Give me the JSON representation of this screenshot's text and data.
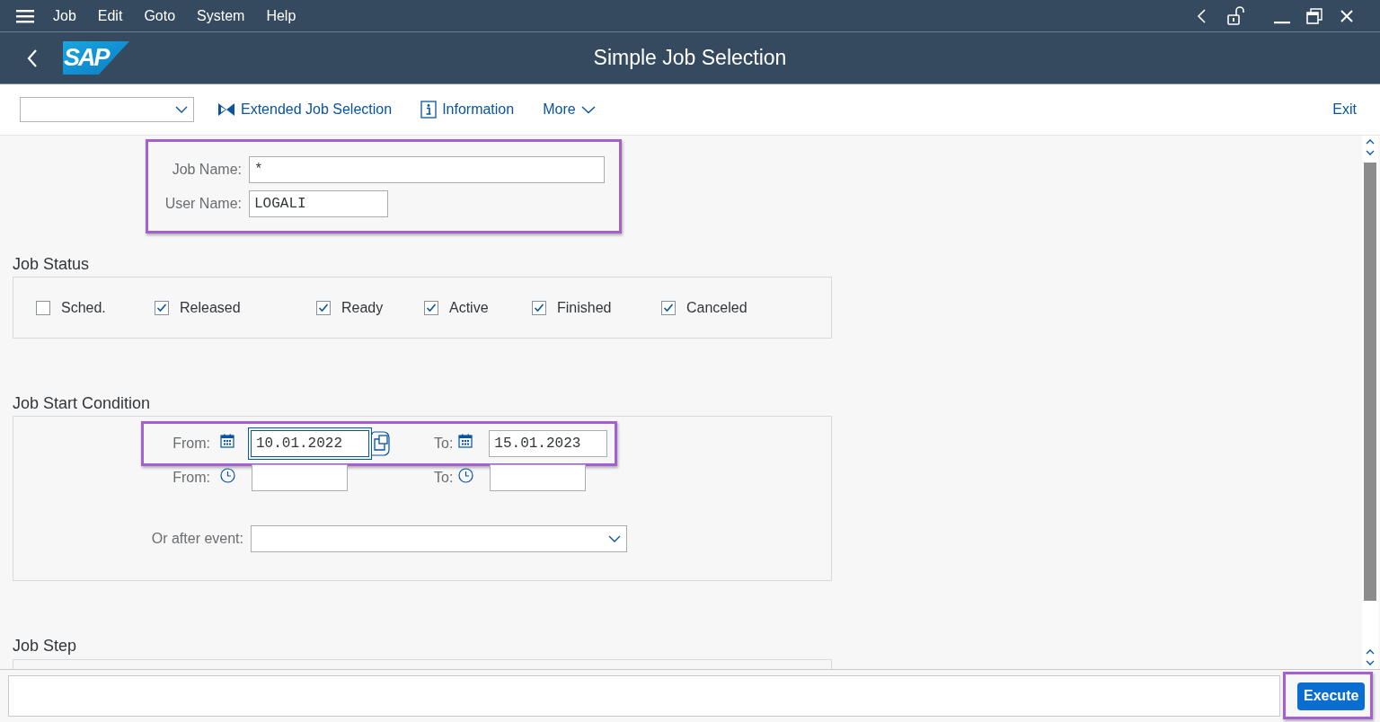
{
  "menu_bar": {
    "items": [
      "Job",
      "Edit",
      "Goto",
      "System",
      "Help"
    ]
  },
  "title_bar": {
    "logo": "SAP",
    "title": "Simple Job Selection"
  },
  "toolbar": {
    "buttons": [
      {
        "kind": "extended",
        "label": "Extended Job Selection"
      },
      {
        "kind": "info",
        "label": "Information"
      },
      {
        "kind": "more",
        "label": "More"
      }
    ],
    "exit": "Exit"
  },
  "selection": {
    "highlighted": true,
    "fields": [
      {
        "label": "Job Name:",
        "value": "*"
      },
      {
        "label": "User Name:",
        "value": "LOGALI"
      }
    ]
  },
  "job_status": {
    "title": "Job Status",
    "options": [
      {
        "label": "Sched.",
        "checked": false
      },
      {
        "label": "Released",
        "checked": true
      },
      {
        "label": "Ready",
        "checked": true
      },
      {
        "label": "Active",
        "checked": true
      },
      {
        "label": "Finished",
        "checked": true
      },
      {
        "label": "Canceled",
        "checked": true
      }
    ]
  },
  "start_condition": {
    "title": "Job Start Condition",
    "date_row": {
      "highlighted": true,
      "from": {
        "label": "From:",
        "value": "10.01.2022",
        "focused": true
      },
      "to": {
        "label": "To:",
        "value": "15.01.2023",
        "focused": false
      }
    },
    "time_row": {
      "from": {
        "label": "From:"
      },
      "to": {
        "label": "To:"
      }
    },
    "event": {
      "label": "Or after event:"
    }
  },
  "job_step": {
    "title": "Job Step"
  },
  "footer": {
    "execute": {
      "label": "Execute",
      "highlighted": true
    }
  }
}
